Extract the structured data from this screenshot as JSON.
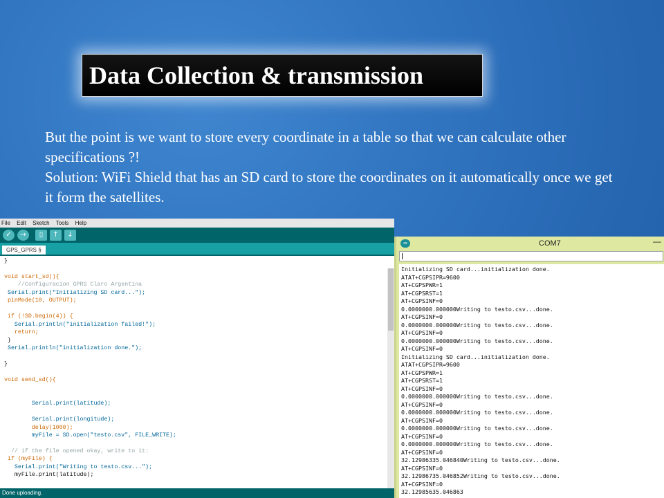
{
  "slide": {
    "title": "Data Collection & transmission",
    "paragraphs": [
      "But the point is we want to store every coordinate in a table so that we can calculate other specifications ?!",
      "Solution: WiFi Shield that has an SD card to store the coordinates on it automatically once we get it form the satellites."
    ]
  },
  "ide": {
    "menu": [
      "File",
      "Edit",
      "Sketch",
      "Tools",
      "Help"
    ],
    "toolbar_icons": [
      "verify-icon",
      "upload-icon",
      "new-icon",
      "open-icon",
      "save-icon"
    ],
    "tab_label": "GPS_GPRS §",
    "status_text": "Done uploading.",
    "code_lines": [
      {
        "t": "}",
        "c": ""
      },
      {
        "t": "",
        "c": ""
      },
      {
        "t": "void start_sd(){",
        "c": "kw"
      },
      {
        "t": "    //Configuracion GPRS Claro Argentina",
        "c": "cm"
      },
      {
        "t": " Serial.print(\"Initializing SD card...\");",
        "c": "st"
      },
      {
        "t": " pinMode(10, OUTPUT);",
        "c": "kw"
      },
      {
        "t": "",
        "c": ""
      },
      {
        "t": " if (!SD.begin(4)) {",
        "c": "kw"
      },
      {
        "t": "   Serial.println(\"initialization failed!\");",
        "c": "st"
      },
      {
        "t": "   return;",
        "c": "kw"
      },
      {
        "t": " }",
        "c": ""
      },
      {
        "t": " Serial.println(\"initialization done.\");",
        "c": "st"
      },
      {
        "t": "",
        "c": ""
      },
      {
        "t": "}",
        "c": ""
      },
      {
        "t": "",
        "c": ""
      },
      {
        "t": "void send_sd(){",
        "c": "kw"
      },
      {
        "t": "",
        "c": ""
      },
      {
        "t": "",
        "c": ""
      },
      {
        "t": "        Serial.print(latitude);",
        "c": "st"
      },
      {
        "t": "",
        "c": ""
      },
      {
        "t": "        Serial.print(longitude);",
        "c": "st"
      },
      {
        "t": "        delay(1000);",
        "c": "kw"
      },
      {
        "t": "        myFile = SD.open(\"testo.csv\", FILE_WRITE);",
        "c": "st"
      },
      {
        "t": "",
        "c": ""
      },
      {
        "t": "  // if the file opened okay, write to it:",
        "c": "cm"
      },
      {
        "t": " if (myFile) {",
        "c": "kw"
      },
      {
        "t": "   Serial.print(\"Writing to testo.csv...\");",
        "c": "st"
      },
      {
        "t": "   myFile.print(latitude);",
        "c": ""
      }
    ]
  },
  "serial": {
    "title": "COM7",
    "min_glyph": "—",
    "icon_glyph": "∞",
    "output": [
      "Initializing SD card...initialization done.",
      "ATAT+CGPSIPR=9600",
      "AT+CGPSPWR=1",
      "AT+CGPSRST=1",
      "AT+CGPSINF=0",
      "0.0000000.000000Writing to testo.csv...done.",
      "AT+CGPSINF=0",
      "0.0000000.000000Writing to testo.csv...done.",
      "AT+CGPSINF=0",
      "0.0000000.000000Writing to testo.csv...done.",
      "AT+CGPSINF=0",
      "Initializing SD card...initialization done.",
      "ATAT+CGPSIPR=9600",
      "AT+CGPSPWR=1",
      "AT+CGPSRST=1",
      "AT+CGPSINF=0",
      "0.0000000.000000Writing to testo.csv...done.",
      "AT+CGPSINF=0",
      "0.0000000.000000Writing to testo.csv...done.",
      "AT+CGPSINF=0",
      "0.0000000.000000Writing to testo.csv...done.",
      "AT+CGPSINF=0",
      "0.0000000.000000Writing to testo.csv...done.",
      "AT+CGPSINF=0",
      "32.12986335.046840Writing to testo.csv...done.",
      "AT+CGPSINF=0",
      "32.12986735.046852Writing to testo.csv...done.",
      "AT+CGPSINF=0",
      "32.12985635.046863"
    ]
  },
  "colors": {
    "slide_bg": "#2f72be",
    "ide_teal": "#006468",
    "ide_tab": "#17a1a5",
    "serial_frame": "#dfe8a0"
  }
}
